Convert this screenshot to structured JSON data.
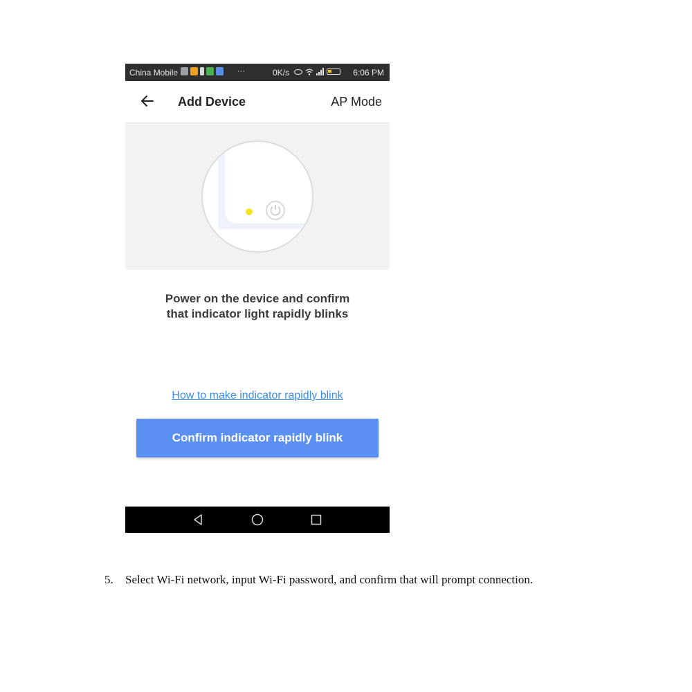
{
  "status_bar": {
    "carrier": "China Mobile",
    "more": "···",
    "speed": "0K/s",
    "time": "6:06 PM"
  },
  "header": {
    "title": "Add Device",
    "mode": "AP Mode"
  },
  "main": {
    "instruction_line1": "Power on the device and confirm",
    "instruction_line2": "that indicator light rapidly blinks",
    "help_link": "How to make indicator rapidly blink",
    "confirm_button": "Confirm indicator rapidly blink"
  },
  "colors": {
    "accent": "#5b8ff2",
    "link": "#3b8ee8",
    "indicator": "#f2e41c"
  },
  "step": {
    "number": "5.",
    "text": "Select Wi-Fi network, input Wi-Fi password, and confirm that will prompt connection."
  }
}
